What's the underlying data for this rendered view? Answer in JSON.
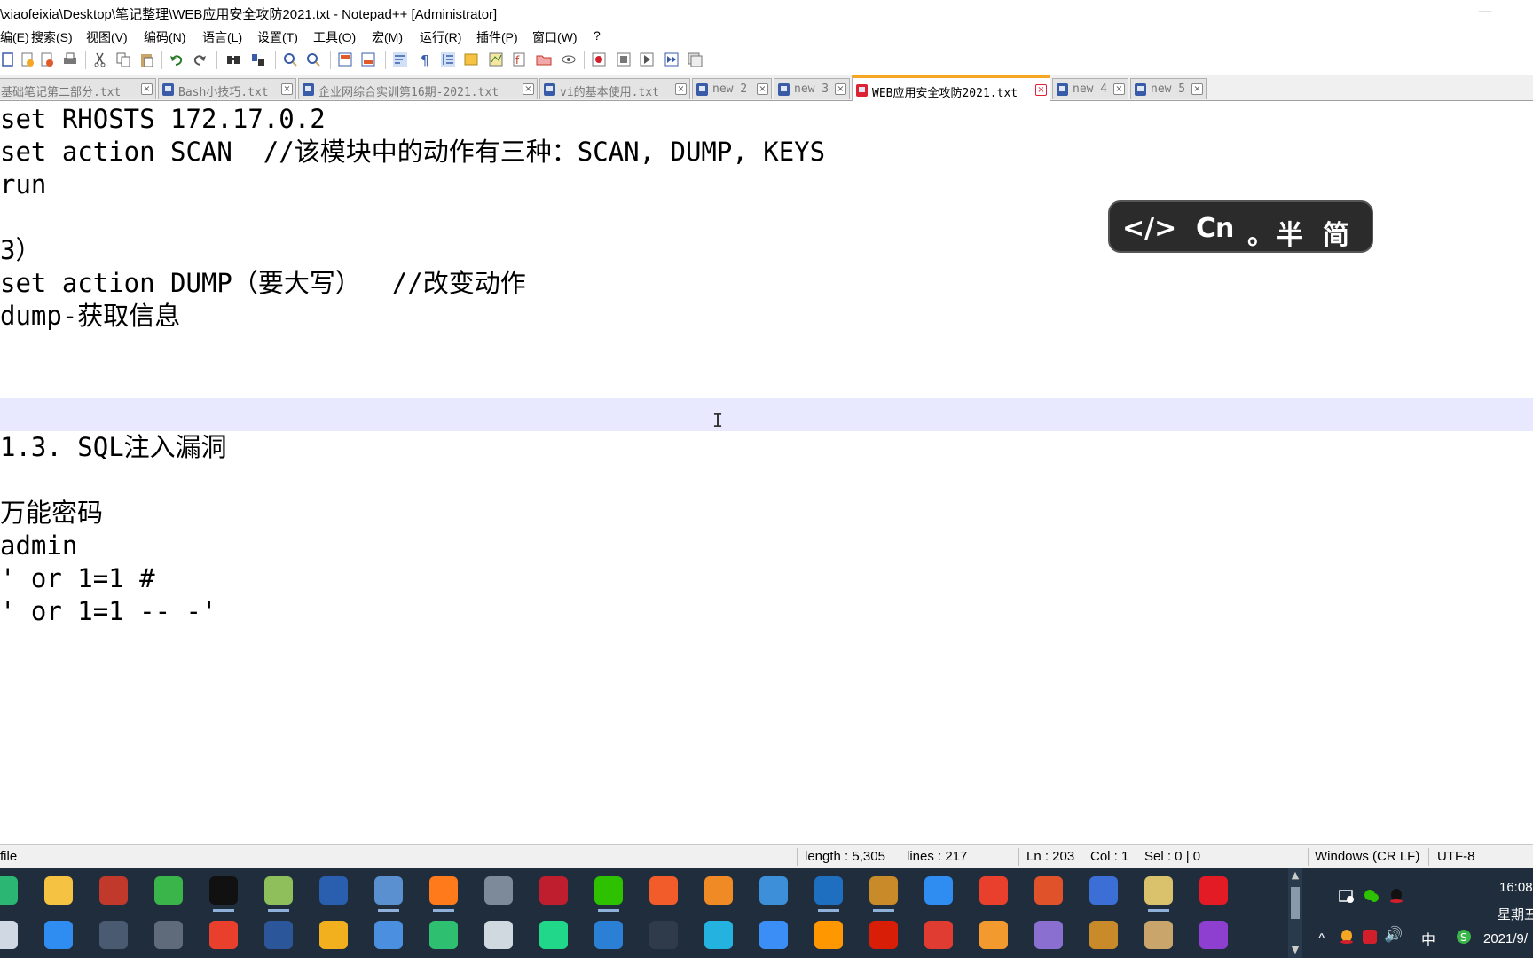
{
  "window": {
    "title": "\\xiaofeixia\\Desktop\\笔记整理\\WEB应用安全攻防2021.txt - Notepad++ [Administrator]",
    "minimize_glyph": "—"
  },
  "menu": [
    "编(E)",
    "搜索(S)",
    "视图(V)",
    "编码(N)",
    "语言(L)",
    "设置(T)",
    "工具(O)",
    "宏(M)",
    "运行(R)",
    "插件(P)",
    "窗口(W)",
    "?"
  ],
  "tabs": [
    {
      "label": "基础笔记第二部分.txt",
      "active": false
    },
    {
      "label": "Bash小技巧.txt",
      "active": false
    },
    {
      "label": "企业网综合实训第16期-2021.txt",
      "active": false
    },
    {
      "label": "vi的基本使用.txt",
      "active": false
    },
    {
      "label": "new 2",
      "active": false
    },
    {
      "label": "new 3",
      "active": false
    },
    {
      "label": "WEB应用安全攻防2021.txt",
      "active": true
    },
    {
      "label": "new 4",
      "active": false
    },
    {
      "label": "new 5",
      "active": false
    }
  ],
  "tab_close_glyph": "×",
  "editor": {
    "lines": [
      "set RHOSTS 172.17.0.2",
      "set action SCAN  //该模块中的动作有三种：SCAN, DUMP, KEYS",
      "run",
      "",
      "3）",
      "set action DUMP（要大写）  //改变动作",
      "dump-获取信息",
      "",
      "",
      "",
      "1.3. SQL注入漏洞",
      "",
      "万能密码",
      "admin",
      "' or 1=1 #",
      "' or 1=1 -- -'"
    ],
    "current_line_index": 9,
    "cursor_glyph": "I"
  },
  "ime": {
    "code": "</>",
    "lang": "Cn",
    "punct": "。",
    "width": "半",
    "script": "简"
  },
  "status": {
    "filetype": "file",
    "length": "length : 5,305",
    "lines": "lines : 217",
    "ln": "Ln : 203",
    "col": "Col : 1",
    "sel": "Sel : 0 | 0",
    "eol": "Windows (CR LF)",
    "encoding": "UTF-8"
  },
  "taskbar": {
    "row1": [
      {
        "name": "edge-icon",
        "color": "#2bb673"
      },
      {
        "name": "file-explorer-icon",
        "color": "#f5c242"
      },
      {
        "name": "app-red-icon",
        "color": "#c0392b"
      },
      {
        "name": "camtasia-icon",
        "color": "#3ab54a"
      },
      {
        "name": "qq-icon",
        "color": "#111111"
      },
      {
        "name": "notepadpp-icon",
        "color": "#8fbf5a"
      },
      {
        "name": "powershell-icon",
        "color": "#2a5fb0"
      },
      {
        "name": "remote-desktop-icon",
        "color": "#5a8fd0"
      },
      {
        "name": "firefox-icon",
        "color": "#ff7a1a"
      },
      {
        "name": "tool-icon",
        "color": "#7d8a99"
      },
      {
        "name": "filezilla-icon",
        "color": "#bf1e2e"
      },
      {
        "name": "wechat-icon",
        "color": "#2dc100"
      },
      {
        "name": "app-orange-icon",
        "color": "#f25c2a"
      },
      {
        "name": "search-app-icon",
        "color": "#f08a24"
      },
      {
        "name": "network-icon",
        "color": "#3c8fd8"
      },
      {
        "name": "wireshark-icon",
        "color": "#1e6fbf"
      },
      {
        "name": "library-icon",
        "color": "#c98b2a"
      },
      {
        "name": "baidu-netdisk-icon",
        "color": "#2f8cf0"
      },
      {
        "name": "wps-icon",
        "color": "#e8402c"
      },
      {
        "name": "app-swirl-icon",
        "color": "#e0522a"
      },
      {
        "name": "save-app-icon",
        "color": "#3b6fd6"
      },
      {
        "name": "paint-icon",
        "color": "#d9c26b"
      },
      {
        "name": "youdao-icon",
        "color": "#e21b24"
      }
    ],
    "row2": [
      {
        "name": "start-icon",
        "color": "#cfd8e3"
      },
      {
        "name": "app-box-icon",
        "color": "#2f8cf0"
      },
      {
        "name": "lock-icon",
        "color": "#4a5a70"
      },
      {
        "name": "vm-icon",
        "color": "#5f6b7a"
      },
      {
        "name": "c-app-icon",
        "color": "#e8402c"
      },
      {
        "name": "word-icon",
        "color": "#2b579a"
      },
      {
        "name": "chrome-icon",
        "color": "#f2b01e"
      },
      {
        "name": "remote-icon",
        "color": "#4b8fe0"
      },
      {
        "name": "xmind-icon",
        "color": "#2fbf71"
      },
      {
        "name": "editor-icon",
        "color": "#d0d8e0"
      },
      {
        "name": "pycharm-icon",
        "color": "#21d789"
      },
      {
        "name": "connect-icon",
        "color": "#2b7fd4"
      },
      {
        "name": "vpn-icon",
        "color": "#2f3a4a"
      },
      {
        "name": "cloud-icon",
        "color": "#24b3e0"
      },
      {
        "name": "feishu-icon",
        "color": "#3a8ef6"
      },
      {
        "name": "sublime-icon",
        "color": "#ff9800"
      },
      {
        "name": "netease-music-icon",
        "color": "#d81e06"
      },
      {
        "name": "browser-icon",
        "color": "#e03c31"
      },
      {
        "name": "fish-icon",
        "color": "#f29a2e"
      },
      {
        "name": "purple-app-icon",
        "color": "#8a6fd0"
      },
      {
        "name": "books-icon",
        "color": "#c98b2a"
      },
      {
        "name": "scroll-icon",
        "color": "#c9a46b"
      },
      {
        "name": "pdf-icon",
        "color": "#8e3fd0"
      }
    ]
  },
  "tray": {
    "ime_indicator": "中",
    "clock_time": "16:08",
    "clock_day": "星期五",
    "clock_date": "2021/9/",
    "expand_glyph": "^",
    "volume_glyph": "🔊"
  }
}
